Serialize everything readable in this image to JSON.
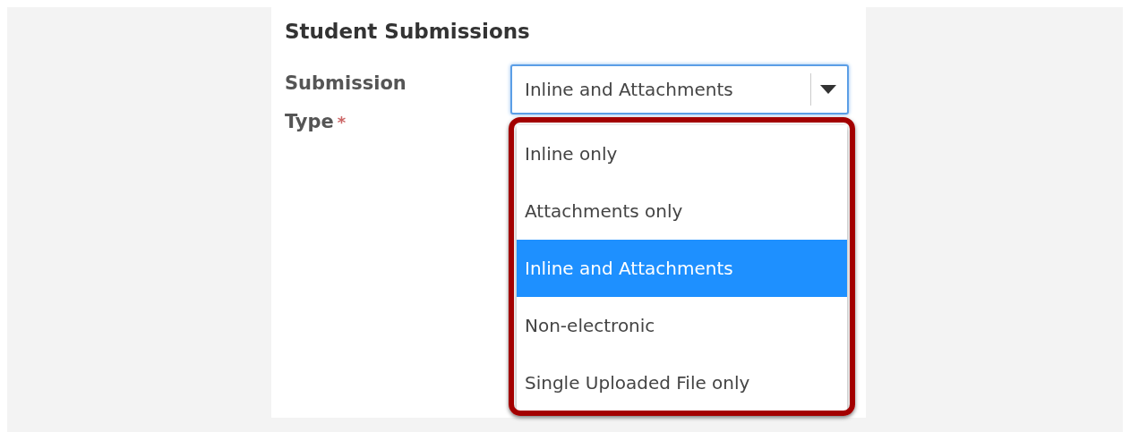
{
  "section": {
    "title": "Student Submissions"
  },
  "field": {
    "label": "Submission Type",
    "required_mark": "*",
    "value": "Inline and Attachments",
    "focused": true,
    "expanded": true,
    "options": [
      {
        "label": "Inline only",
        "selected": false
      },
      {
        "label": "Attachments only",
        "selected": false
      },
      {
        "label": "Inline and Attachments",
        "selected": true
      },
      {
        "label": "Non-electronic",
        "selected": false
      },
      {
        "label": "Single Uploaded File only",
        "selected": false
      }
    ]
  },
  "annotation": {
    "kind": "outline",
    "color": "#a30000"
  }
}
